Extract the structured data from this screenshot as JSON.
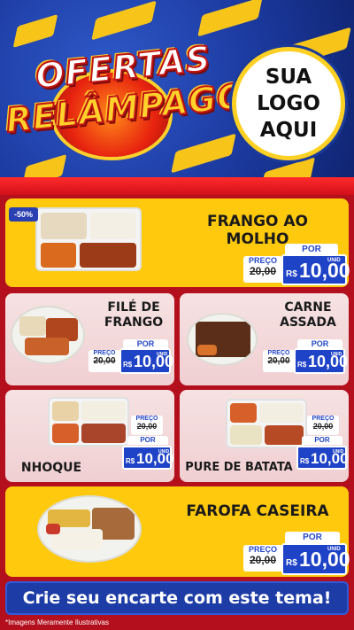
{
  "header": {
    "brand_line1": "OFERTAS",
    "brand_line2": "RELÂMPAGO",
    "logo_line1": "SUA",
    "logo_line2": "LOGO",
    "logo_line3": "AQUI"
  },
  "colors": {
    "yellow": "#ffc90e",
    "blue": "#1f43c7",
    "red": "#b30f1c",
    "pink": "#f2d6d8"
  },
  "products": [
    {
      "name": "FRANGO AO MOLHO",
      "badge": "-50%",
      "preco_label": "PREÇO",
      "old_price": "20,00",
      "por_label": "POR",
      "currency": "R$",
      "price": "10,00",
      "unit": "UNID"
    },
    {
      "name_line1": "FILÉ DE",
      "name_line2": "FRANGO",
      "preco_label": "PREÇO",
      "old_price": "20,00",
      "por_label": "POR",
      "currency": "R$",
      "price": "10,00",
      "unit": "UNID"
    },
    {
      "name_line1": "CARNE",
      "name_line2": "ASSADA",
      "preco_label": "PREÇO",
      "old_price": "20,00",
      "por_label": "POR",
      "currency": "R$",
      "price": "10,00",
      "unit": "UNID"
    },
    {
      "name": "NHOQUE",
      "preco_label": "PREÇO",
      "old_price": "20,00",
      "por_label": "POR",
      "currency": "R$",
      "price": "10,00",
      "unit": "UNID"
    },
    {
      "name": "PURE DE BATATA",
      "preco_label": "PREÇO",
      "old_price": "20,00",
      "por_label": "POR",
      "currency": "R$",
      "price": "10,00",
      "unit": "UNID"
    },
    {
      "name": "FAROFA CASEIRA",
      "preco_label": "PREÇO",
      "old_price": "20,00",
      "por_label": "POR",
      "currency": "R$",
      "price": "10,00",
      "unit": "UNID"
    }
  ],
  "cta": "Crie seu encarte com este tema!",
  "footnote": "*Imagens Meramente Ilustrativas"
}
